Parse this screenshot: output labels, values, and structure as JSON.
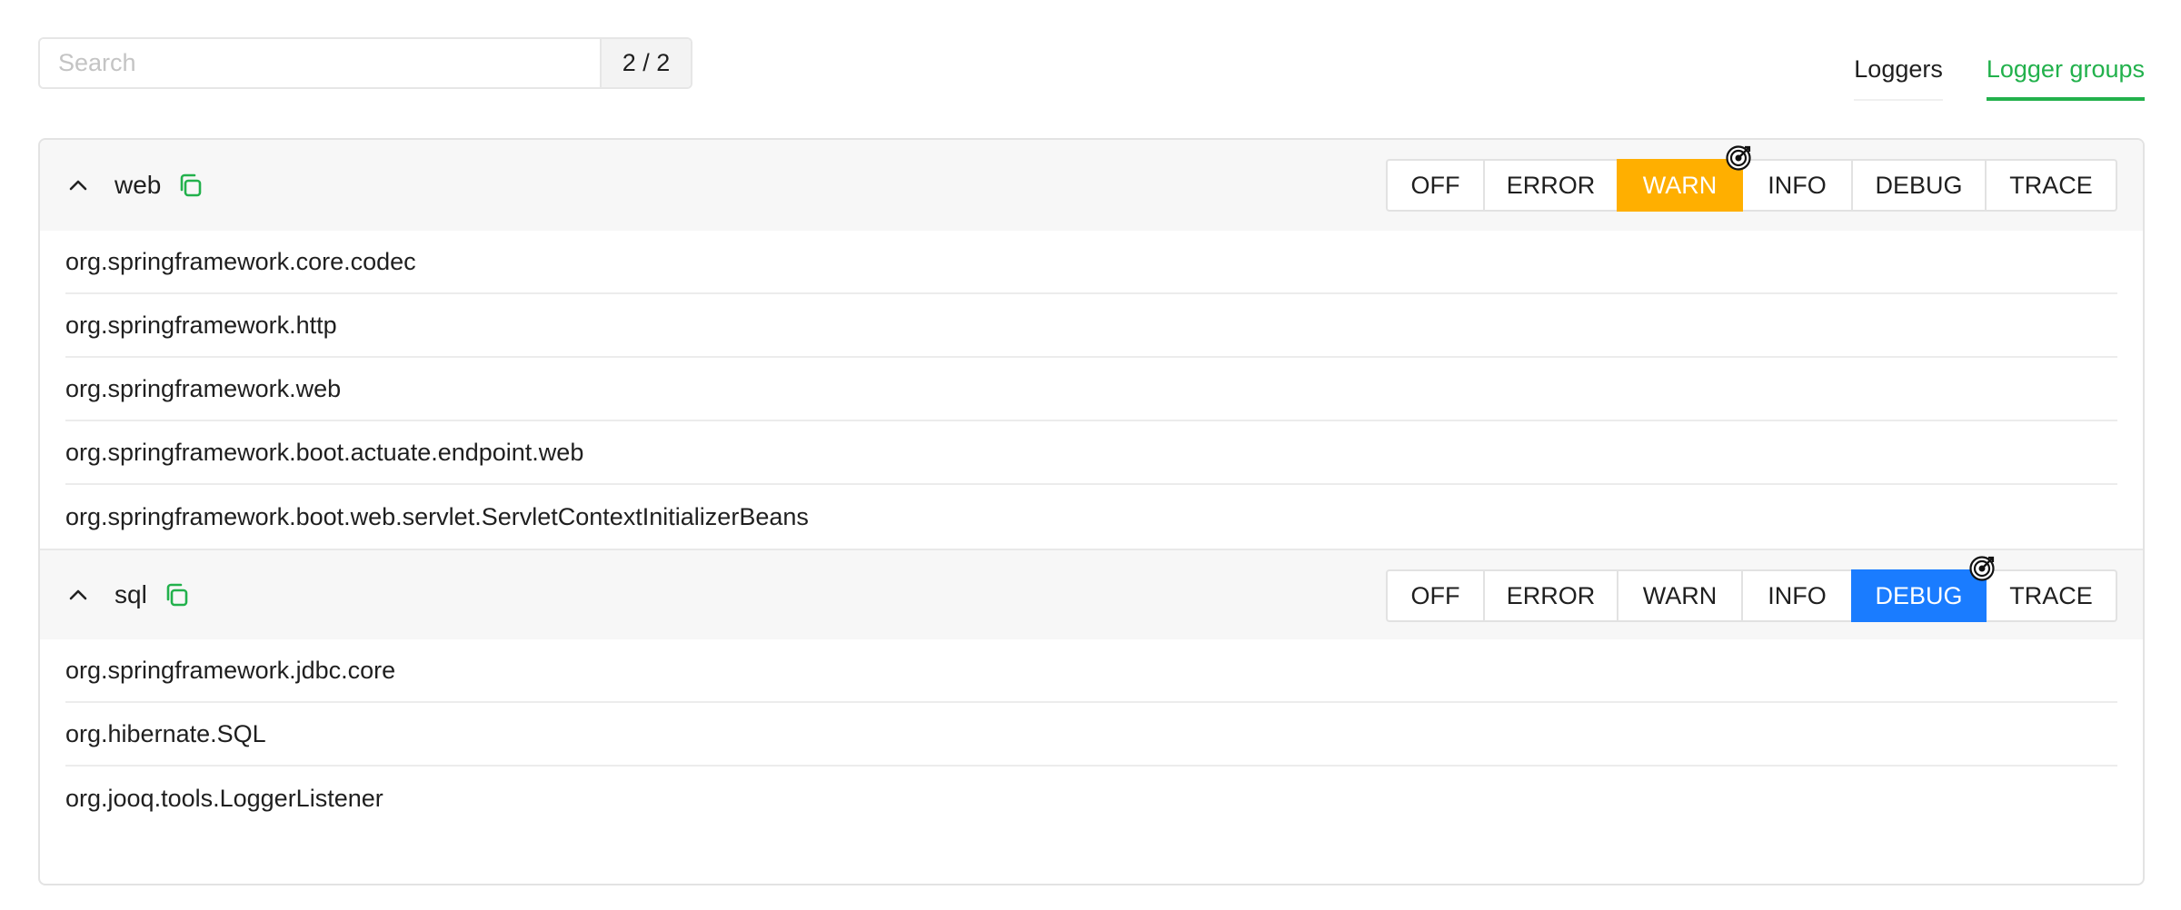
{
  "search": {
    "placeholder": "Search",
    "value": "",
    "count": "2 / 2"
  },
  "tabs": [
    {
      "label": "Loggers",
      "active": false
    },
    {
      "label": "Logger groups",
      "active": true
    }
  ],
  "accent_color": "#22b14c",
  "level_colors": {
    "WARN": "#ffaf00",
    "DEBUG": "#1a7cff"
  },
  "groups": [
    {
      "name": "web",
      "expanded": true,
      "levels": [
        "OFF",
        "ERROR",
        "WARN",
        "INFO",
        "DEBUG",
        "TRACE"
      ],
      "active_level": "WARN",
      "loggers": [
        "org.springframework.core.codec",
        "org.springframework.http",
        "org.springframework.web",
        "org.springframework.boot.actuate.endpoint.web",
        "org.springframework.boot.web.servlet.ServletContextInitializerBeans"
      ]
    },
    {
      "name": "sql",
      "expanded": true,
      "levels": [
        "OFF",
        "ERROR",
        "WARN",
        "INFO",
        "DEBUG",
        "TRACE"
      ],
      "active_level": "DEBUG",
      "loggers": [
        "org.springframework.jdbc.core",
        "org.hibernate.SQL",
        "org.jooq.tools.LoggerListener"
      ]
    }
  ]
}
